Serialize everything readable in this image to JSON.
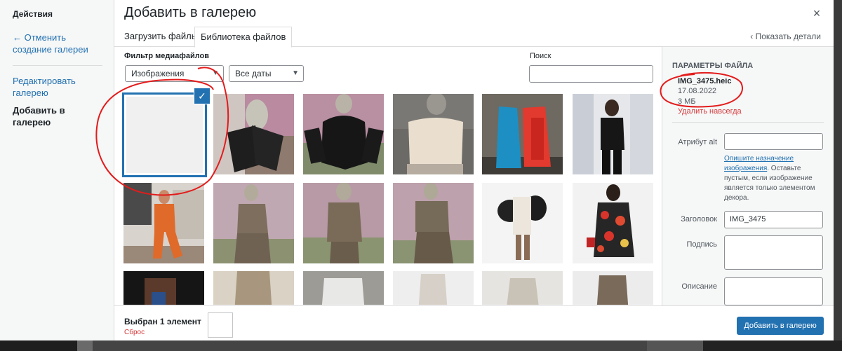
{
  "menu": {
    "title": "Действия",
    "cancel_label": "← Отменить создание галереи",
    "edit_label": "Редактировать галерею",
    "add_label": "Добавить в галерею"
  },
  "frame": {
    "title": "Добавить в галерею",
    "close_label": "×"
  },
  "tabs": {
    "upload": "Загрузить файлы",
    "library": "Библиотека файлов",
    "details_toggle": "‹ Показать детали"
  },
  "toolbar": {
    "filter_label": "Фильтр медиафайлов",
    "type_filter": "Изображения",
    "date_filter": "Все даты",
    "search_label": "Поиск",
    "search_value": ""
  },
  "details": {
    "heading": "Параметры файла",
    "filename": "IMG_3475.heic",
    "date": "17.08.2022",
    "size": "3 МБ",
    "delete_label": "Удалить навсегда",
    "alt_label": "Атрибут alt",
    "alt_value": "",
    "alt_help_link": "Опишите назначение изображения",
    "alt_help_rest": ". Оставьте пустым, если изображение является только элементом декора.",
    "title_label": "Заголовок",
    "title_value": "IMG_3475",
    "caption_label": "Подпись",
    "caption_value": "",
    "description_label": "Описание",
    "description_value": ""
  },
  "bottom": {
    "selected_count": "Выбран 1 элемент",
    "reset_label": "Сброс",
    "insert_label": "Добавить в галерею"
  },
  "colors": {
    "accent": "#2271b1",
    "danger": "#d63638",
    "annotation": "#e31b1b"
  }
}
